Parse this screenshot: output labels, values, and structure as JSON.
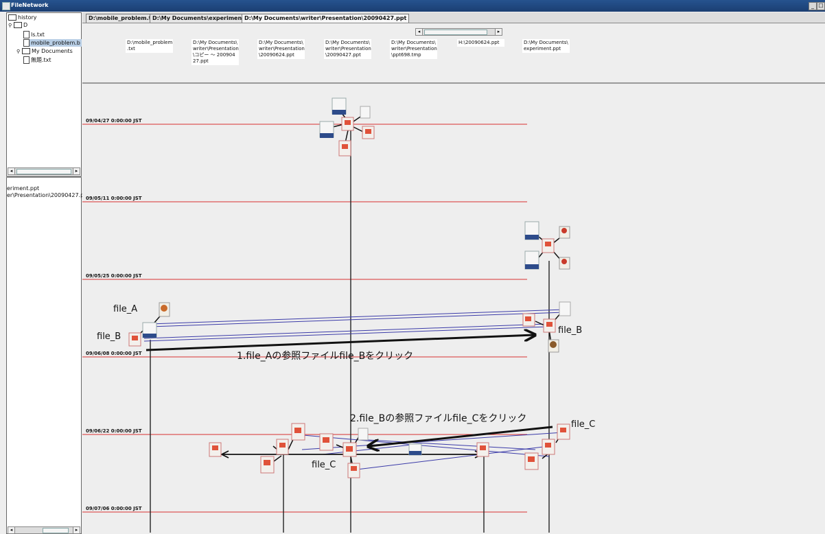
{
  "window": {
    "title": "FileNetwork",
    "minimize": "_",
    "maximize": "☐"
  },
  "tree": {
    "root": "history",
    "drive": "D",
    "items": [
      "ls.txt",
      "mobile_problem.b",
      "My Documents",
      "無題.txt"
    ]
  },
  "left_lines": [
    "eriment.ppt",
    "er\\Presentation\\20090427.ppt"
  ],
  "tabs": [
    "D:\\mobile_problem.txt",
    "D:\\My Documents\\experiment.ppt",
    "D:\\My Documents\\writer\\Presentation\\20090427.ppt"
  ],
  "columns": [
    "D:\\mobile_problem\n.txt",
    "D:\\My Documents\\\nwriter\\Presentation\n\\コピー ～ 200904\n27.ppt",
    "D:\\My Documents\\\nwriter\\Presentation\n\\20090624.ppt",
    "D:\\My Documents\\\nwriter\\Presentation\n\\20090427.ppt",
    "D:\\My Documents\\\nwriter\\Presentation\n\\ppt698.tmp",
    "H:\\20090624.ppt",
    "D:\\My Documents\\\nexperiment.ppt"
  ],
  "dates": [
    "09/04/27 0:00:00 JST",
    "09/05/11 0:00:00 JST",
    "09/05/25 0:00:00 JST",
    "09/06/08 0:00:00 JST",
    "09/06/22 0:00:00 JST",
    "09/07/06 0:00:00 JST"
  ],
  "annotations": {
    "file_a": "file_A",
    "file_b_left": "file_B",
    "file_b_right": "file_B",
    "step1": "1.file_Aの参照ファイルfile_Bをクリック",
    "step2": "2.file_Bの参照ファイルfile_Cをクリック",
    "file_c_right": "file_C",
    "file_c_center": "file_C"
  },
  "colors": {
    "timeline": "#d83030",
    "link": "#3a3aa8",
    "arrow": "#111111"
  },
  "file_icons": [
    "txt-icon",
    "ppt-icon",
    "image-icon",
    "script-icon"
  ]
}
